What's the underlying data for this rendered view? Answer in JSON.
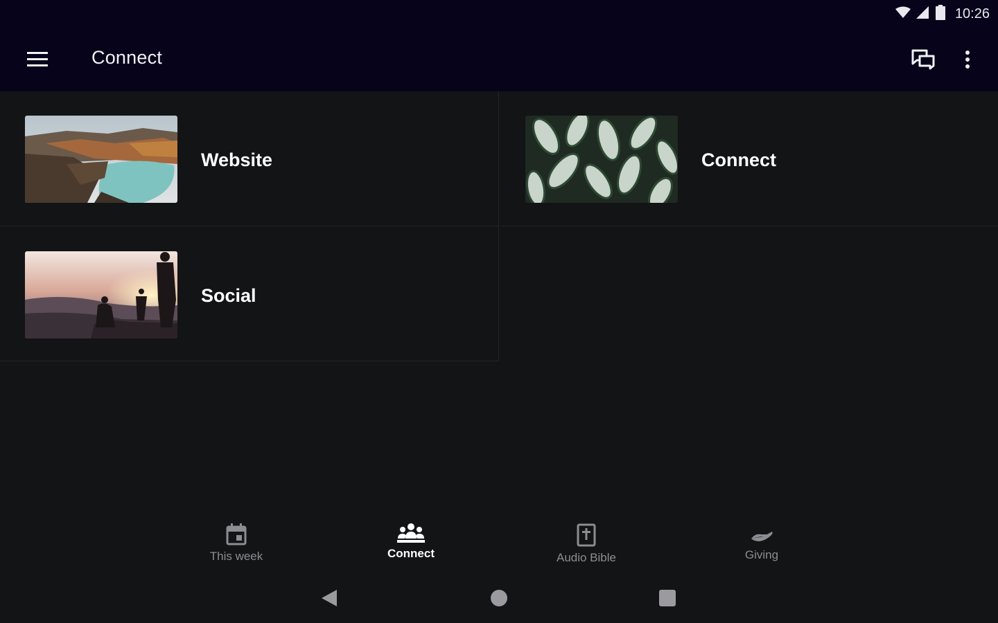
{
  "status_bar": {
    "time": "10:26"
  },
  "app_bar": {
    "title": "Connect"
  },
  "cards": [
    {
      "label": "Website",
      "image": "crater-lake-photo"
    },
    {
      "label": "Connect",
      "image": "leaves-photo"
    },
    {
      "label": "Social",
      "image": "sunset-hikers-photo"
    }
  ],
  "bottom_nav": [
    {
      "label": "This week",
      "icon": "calendar-icon",
      "active": false
    },
    {
      "label": "Connect",
      "icon": "group-icon",
      "active": true
    },
    {
      "label": "Audio Bible",
      "icon": "bible-icon",
      "active": false
    },
    {
      "label": "Giving",
      "icon": "giving-hand-icon",
      "active": false
    }
  ],
  "colors": {
    "app_bar_bg": "#06031a",
    "content_bg": "#131416",
    "divider": "#23252a",
    "inactive_text": "#8c8d92"
  }
}
